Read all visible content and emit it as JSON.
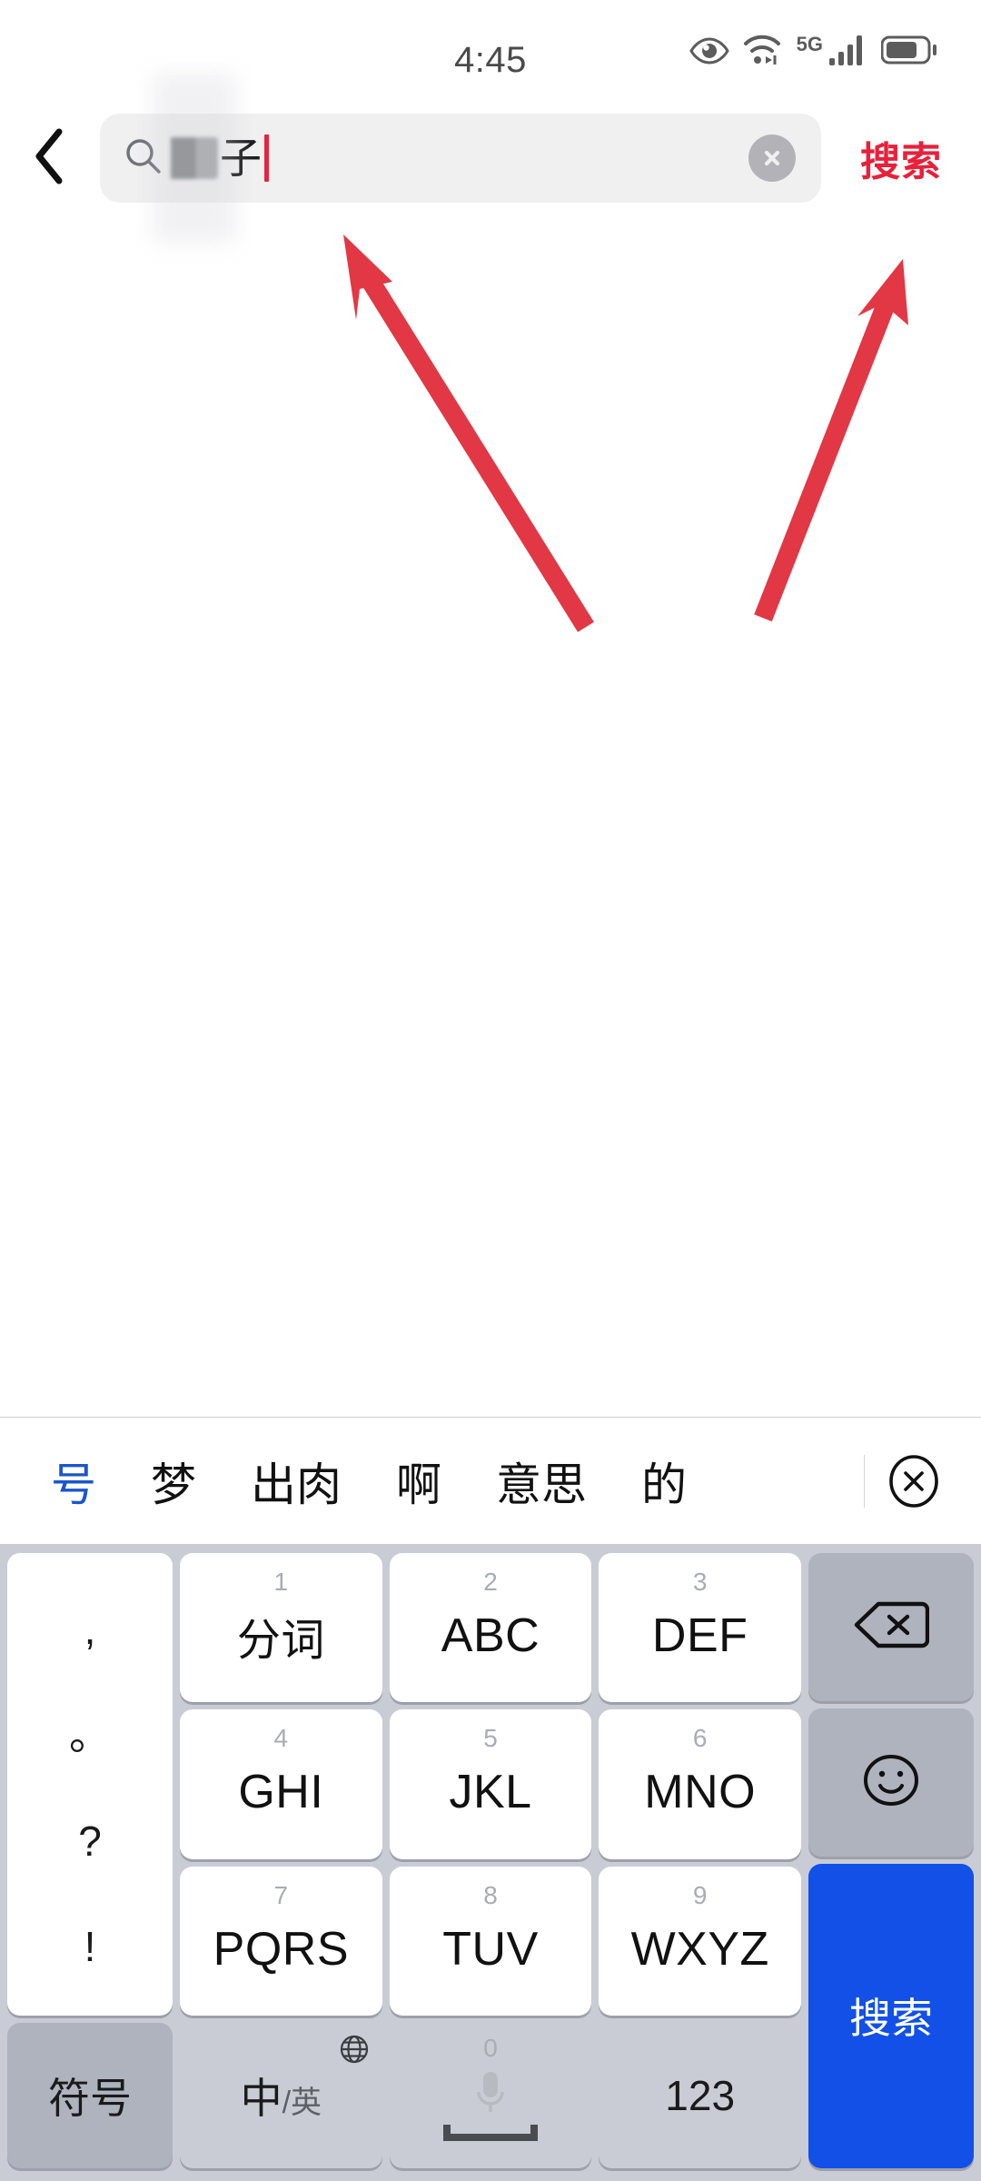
{
  "status_bar": {
    "time": "4:45",
    "network_label": "5G",
    "icons": [
      "eye-care-icon",
      "wifi-icon",
      "signal-bars-icon",
      "battery-icon"
    ]
  },
  "search_header": {
    "back_icon": "back-chevron-icon",
    "search_icon": "magnifier-icon",
    "query_redacted": "",
    "query_text": "子",
    "clear_icon": "clear-circle-icon",
    "action_label": "搜索"
  },
  "annotations": {
    "arrow_color": "#e23744",
    "arrows": [
      {
        "name": "arrow-to-search-input",
        "points_to": "search-input"
      },
      {
        "name": "arrow-to-search-button",
        "points_to": "search-action-button"
      }
    ]
  },
  "keyboard": {
    "suggestions": [
      "号",
      "梦",
      "出肉",
      "啊",
      "意思",
      "的"
    ],
    "active_suggestion_index": 0,
    "close_icon": "circled-x-icon",
    "punctuation": [
      ",",
      "。",
      "?",
      "!"
    ],
    "rows": [
      [
        {
          "digit": "1",
          "label": "分词",
          "cjk": true
        },
        {
          "digit": "2",
          "label": "ABC",
          "cjk": false
        },
        {
          "digit": "3",
          "label": "DEF",
          "cjk": false
        }
      ],
      [
        {
          "digit": "4",
          "label": "GHI",
          "cjk": false
        },
        {
          "digit": "5",
          "label": "JKL",
          "cjk": false
        },
        {
          "digit": "6",
          "label": "MNO",
          "cjk": false
        }
      ],
      [
        {
          "digit": "7",
          "label": "PQRS",
          "cjk": false
        },
        {
          "digit": "8",
          "label": "TUV",
          "cjk": false
        },
        {
          "digit": "9",
          "label": "WXYZ",
          "cjk": false
        }
      ]
    ],
    "right_column": {
      "backspace_icon": "backspace-icon",
      "emoji_icon": "emoji-smiley-icon",
      "enter_label": "搜索"
    },
    "bottom_row": {
      "symbols_label": "符号",
      "lang_main": "中",
      "lang_sub": "/英",
      "globe_icon": "globe-icon",
      "space_digit": "0",
      "mic_icon": "microphone-icon",
      "space_icon": "spacebar-icon",
      "numeric_label": "123"
    },
    "colors": {
      "keyboard_bg": "#c9ccd4",
      "key_white": "#ffffff",
      "key_gray": "#aeb3be",
      "key_blue": "#1250e8",
      "suggestion_active": "#1a56c8"
    }
  }
}
